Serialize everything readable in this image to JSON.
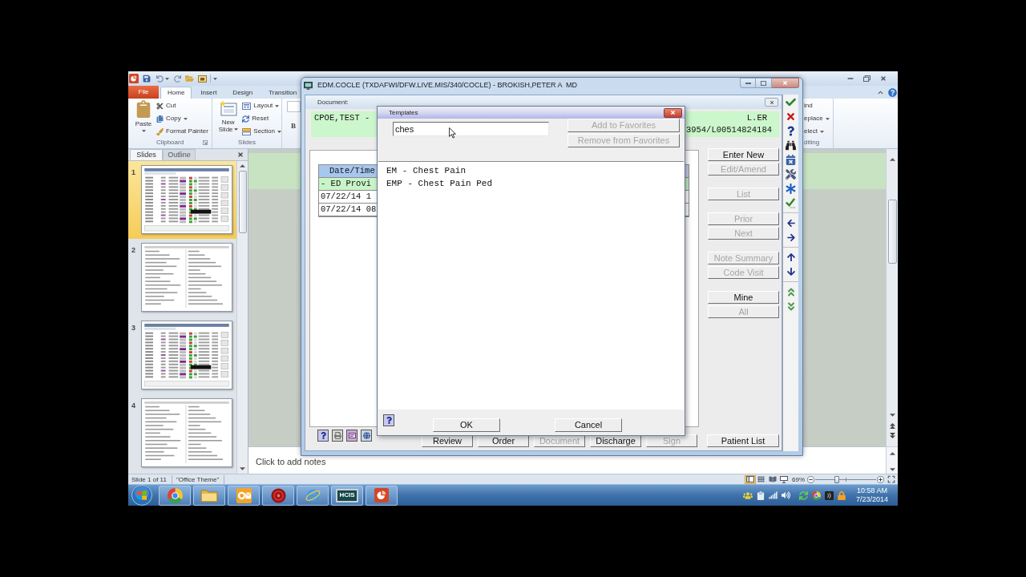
{
  "powerpoint": {
    "ribbon_tabs": [
      {
        "label": "File",
        "kind": "file",
        "selected": false
      },
      {
        "label": "Home",
        "kind": "tab",
        "selected": true
      },
      {
        "label": "Insert",
        "kind": "tab",
        "selected": false
      },
      {
        "label": "Design",
        "kind": "tab",
        "selected": false
      },
      {
        "label": "Transition",
        "kind": "tab",
        "selected": false
      }
    ],
    "ribbon_groups": [
      {
        "kind": "clipboard",
        "label": "Clipboard",
        "large": {
          "label": "Paste",
          "dropdown": true
        },
        "items": [
          {
            "label": "Cut",
            "dropdown": false
          },
          {
            "label": "Copy",
            "dropdown": true
          },
          {
            "label": "Format Painter",
            "dropdown": false
          }
        ]
      },
      {
        "kind": "slides",
        "label": "Slides",
        "large": {
          "label": "New Slide",
          "dropdown": true
        },
        "items": [
          {
            "label": "Layout",
            "dropdown": true
          },
          {
            "label": "Reset",
            "dropdown": false
          },
          {
            "label": "Section",
            "dropdown": true
          }
        ]
      },
      {
        "kind": "font",
        "items": [
          {
            "label": "B"
          }
        ]
      }
    ],
    "editing_group": {
      "items": [
        {
          "label": "ind",
          "dropdown": false
        },
        {
          "label": "eplace",
          "dropdown": true
        },
        {
          "label": "elect",
          "dropdown": true
        }
      ],
      "label": "diting"
    },
    "slide_panel": {
      "tabs": [
        {
          "label": "Slides",
          "selected": true
        },
        {
          "label": "Outline",
          "selected": false
        }
      ],
      "slides": [
        {
          "number": "1",
          "kind": "grid",
          "selected": true
        },
        {
          "number": "2",
          "kind": "document",
          "selected": false
        },
        {
          "number": "3",
          "kind": "grid",
          "selected": false
        },
        {
          "number": "4",
          "kind": "document",
          "selected": false
        }
      ]
    },
    "notes": {
      "placeholder": "Click to add notes"
    },
    "status_bar": {
      "slide": "Slide 1 of 11",
      "theme": "\"Office Theme\"",
      "view_buttons": [
        {
          "kind": "normal",
          "selected": true
        },
        {
          "kind": "sorter",
          "selected": false
        },
        {
          "kind": "reading",
          "selected": false
        },
        {
          "kind": "slideshow",
          "selected": false
        }
      ],
      "zoom": "69%",
      "zoom_slider": {
        "level": 0.36
      }
    }
  },
  "edm_window": {
    "title": "EDM.COCLE (TXDAFWI/DFW.LIVE.MIS/340/COCLE) - BROKISH,PETER A  MD",
    "document_title": "Document:",
    "patient": {
      "name": "CPOE,TEST -",
      "location": "L.ER",
      "account": "3954/L00514824184"
    },
    "table": {
      "columns": [
        "Date/Time"
      ],
      "rows": [
        {
          "kind": "group",
          "cells": [
            "- ED Provi"
          ]
        },
        {
          "kind": "entry",
          "cells": [
            "07/22/14 1"
          ]
        },
        {
          "kind": "entry",
          "cells": [
            "07/22/14 08"
          ]
        }
      ]
    },
    "side_button_groups": [
      {
        "buttons": [
          {
            "label": "Enter New",
            "disabled": false
          },
          {
            "label": "Edit/Amend",
            "disabled": true
          }
        ]
      },
      {
        "buttons": [
          {
            "label": "List",
            "disabled": true
          }
        ]
      },
      {
        "buttons": [
          {
            "label": "Prior",
            "disabled": true
          },
          {
            "label": "Next",
            "disabled": true
          }
        ]
      },
      {
        "buttons": [
          {
            "label": "Note Summary",
            "disabled": true
          },
          {
            "label": "Code Visit",
            "disabled": true
          }
        ]
      },
      {
        "buttons": [
          {
            "label": "Mine",
            "disabled": false
          },
          {
            "label": "All",
            "disabled": true
          }
        ]
      }
    ],
    "bottom_buttons": [
      {
        "label": "Review",
        "disabled": false
      },
      {
        "label": "Order",
        "disabled": false
      },
      {
        "label": "Document",
        "disabled": true
      },
      {
        "label": "Discharge",
        "disabled": false
      },
      {
        "label": "Sign",
        "disabled": true
      },
      {
        "label": "Patient List",
        "disabled": false
      }
    ]
  },
  "templates_dialog": {
    "title": "Templates",
    "search": {
      "value": "ches"
    },
    "buttons": [
      {
        "label": "Add to Favorites",
        "disabled": true
      },
      {
        "label": "Remove from Favorites",
        "disabled": true
      }
    ],
    "items": [
      "EM - Chest Pain",
      "EMP - Chest Pain Ped"
    ],
    "footer_buttons": [
      {
        "label": "OK",
        "disabled": false
      },
      {
        "label": "Cancel",
        "disabled": false
      }
    ]
  },
  "taskbar": {
    "apps": [
      {
        "kind": "tricolor"
      },
      {
        "kind": "folder"
      },
      {
        "kind": "mail"
      },
      {
        "kind": "target"
      },
      {
        "kind": "swoosh"
      },
      {
        "kind": "monitor",
        "label": "HCIS"
      },
      {
        "kind": "presentation"
      }
    ],
    "clock": {
      "time": "10:58 AM",
      "date": "7/23/2014"
    }
  }
}
